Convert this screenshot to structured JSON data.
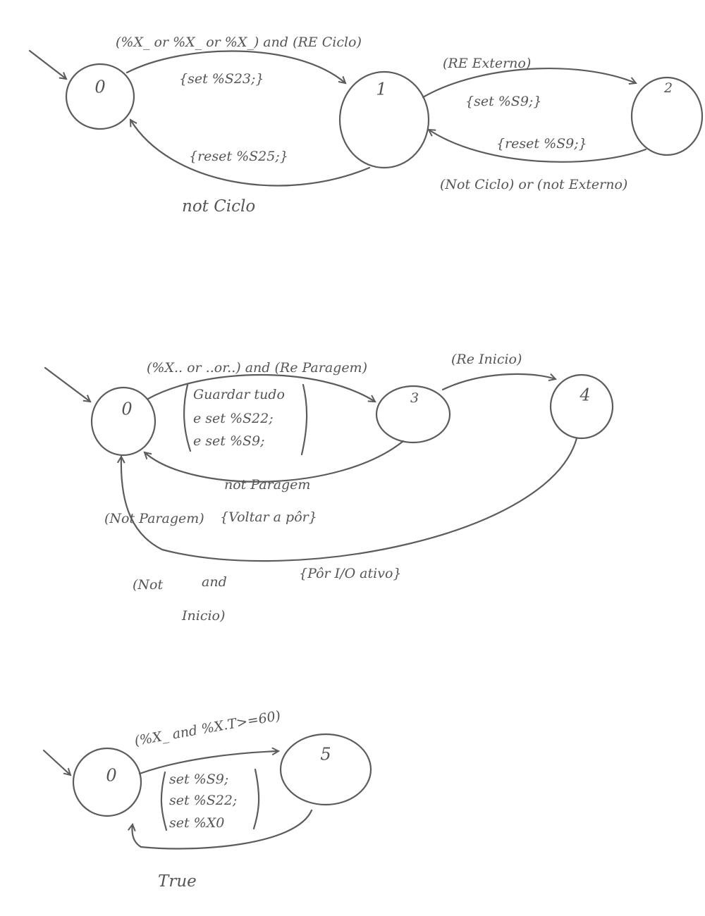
{
  "diagram1": {
    "states": [
      "0",
      "1",
      "2"
    ],
    "t_0_1_guard": "(%X_ or %X_ or %X_) and (RE Ciclo)",
    "t_0_1_action": "{set %S23;}",
    "t_1_2_guard": "(RE Externo)",
    "t_1_2_action": "{set %S9;}",
    "t_2_1_action": "{reset %S9;}",
    "t_2_1_guard": "(Not Ciclo) or (not Externo)",
    "t_1_0_action": "{reset %S25;}",
    "t_1_0_guard": "not Ciclo"
  },
  "diagram2": {
    "states": [
      "0",
      "3",
      "4"
    ],
    "t_0_3_guard": "(%X.. or ..or..) and (Re Paragem)",
    "t_0_3_action_lines": [
      "Guardar tudo",
      "e set %S22;",
      "e set %S9;"
    ],
    "t_3_4_guard": "(Re Inicio)",
    "t_3_0_guard": "not Paragem",
    "t_3_0_action": "{Voltar a pôr}",
    "t_4_0_guard_1": "(Not Paragem)",
    "t_4_0_guard_and": "and",
    "t_4_0_guard_2": "(Not",
    "t_4_0_guard_3": "Inicio)",
    "t_4_0_action": "{Pôr I/O ativo}"
  },
  "diagram3": {
    "states": [
      "0",
      "5"
    ],
    "t_0_5_guard": "(%X_ and %X.T>=60)",
    "t_0_5_action_lines": [
      "set %S9;",
      "set %S22;",
      "set %X0"
    ],
    "t_5_0_guard": "True"
  }
}
